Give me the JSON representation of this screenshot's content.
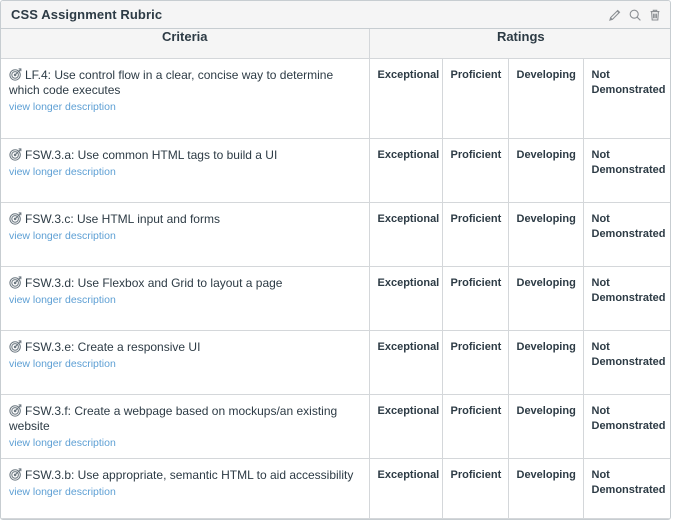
{
  "header": {
    "title": "CSS Assignment Rubric",
    "actions": [
      {
        "name": "edit-rubric-icon",
        "label": "pencil-icon"
      },
      {
        "name": "search-rubric-icon",
        "label": "search-icon"
      },
      {
        "name": "delete-rubric-icon",
        "label": "trash-icon"
      }
    ]
  },
  "table": {
    "columns": {
      "criteria": "Criteria",
      "ratings": "Ratings"
    },
    "ratings_labels": [
      "Exceptional",
      "Proficient",
      "Developing",
      "Not Demonstrated"
    ],
    "longer_description_label": "view longer description",
    "rows": [
      {
        "outcome_icon": "target-icon",
        "criterion": "LF.4: Use control flow in a clear, concise way to determine which code executes",
        "ratings": [
          "Exceptional",
          "Proficient",
          "Developing",
          "Not Demonstrated"
        ]
      },
      {
        "outcome_icon": "target-icon",
        "criterion": "FSW.3.a: Use common HTML tags to build a UI",
        "ratings": [
          "Exceptional",
          "Proficient",
          "Developing",
          "Not Demonstrated"
        ]
      },
      {
        "outcome_icon": "target-icon",
        "criterion": "FSW.3.c: Use HTML input and forms",
        "ratings": [
          "Exceptional",
          "Proficient",
          "Developing",
          "Not Demonstrated"
        ]
      },
      {
        "outcome_icon": "target-icon",
        "criterion": "FSW.3.d: Use Flexbox and Grid to layout a page",
        "ratings": [
          "Exceptional",
          "Proficient",
          "Developing",
          "Not Demonstrated"
        ]
      },
      {
        "outcome_icon": "target-icon",
        "criterion": "FSW.3.e: Create a responsive UI",
        "ratings": [
          "Exceptional",
          "Proficient",
          "Developing",
          "Not Demonstrated"
        ]
      },
      {
        "outcome_icon": "target-icon",
        "criterion": "FSW.3.f: Create a webpage based on mockups/an existing website",
        "ratings": [
          "Exceptional",
          "Proficient",
          "Developing",
          "Not Demonstrated"
        ]
      },
      {
        "outcome_icon": "target-icon",
        "criterion": "FSW.3.b: Use appropriate, semantic HTML to aid accessibility",
        "ratings": [
          "Exceptional",
          "Proficient",
          "Developing",
          "Not Demonstrated"
        ]
      }
    ]
  },
  "colors": {
    "header_bg": "#f5f5f5",
    "border": "#c7cdd1",
    "text": "#2d3b45",
    "link": "#5d9fd4",
    "icon": "#8b8f93"
  }
}
